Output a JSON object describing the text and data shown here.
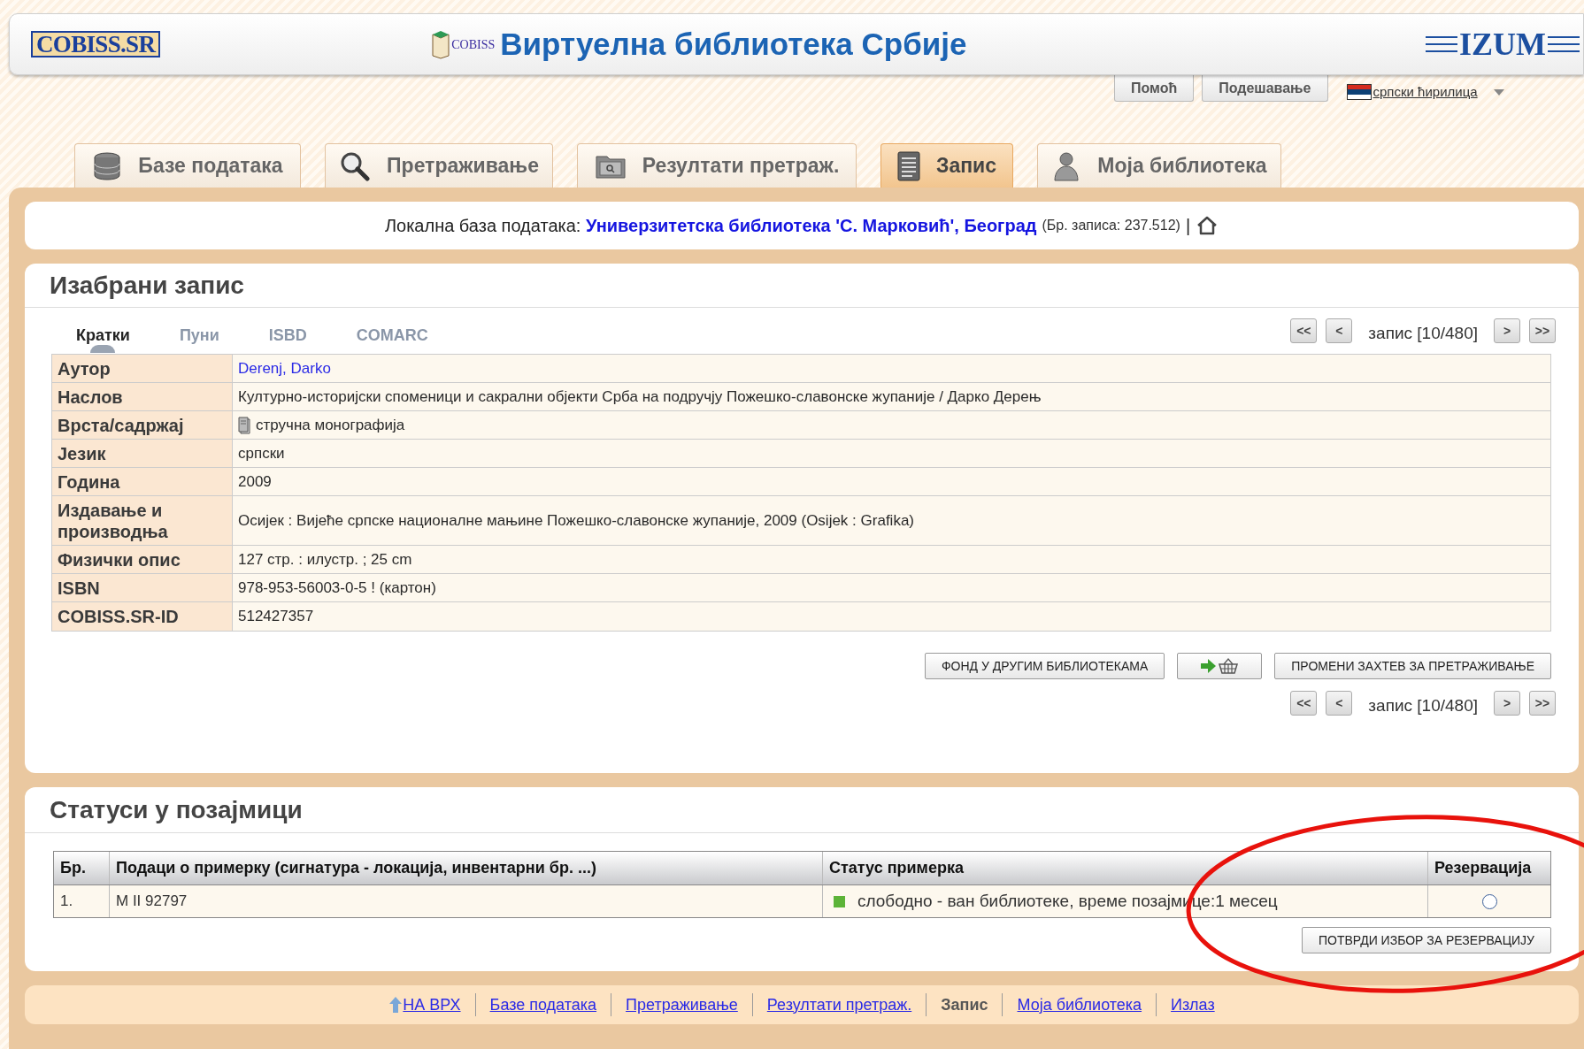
{
  "header": {
    "logo": "COBISS.SR",
    "emblem_text": "COBISS",
    "title": "Виртуелна библиотека Србије",
    "brand": "IZUM"
  },
  "top_buttons": [
    "Помоћ",
    "Подешавање"
  ],
  "language": {
    "label": "српски ћирилица"
  },
  "main_tabs": [
    {
      "label": "Базе података",
      "selected": false
    },
    {
      "label": "Претраживање",
      "selected": false
    },
    {
      "label": "Резултати претраж.",
      "selected": false
    },
    {
      "label": "Запис",
      "selected": true
    },
    {
      "label": "Моја библиотека",
      "selected": false
    }
  ],
  "database_bar": {
    "prefix": "Локална база података:",
    "library": "Универзитетска библиотека 'С. Марковић', Београд",
    "count": "(Бр. записа: 237.512)",
    "separator": "|"
  },
  "record_panel": {
    "title": "Изабрани запис",
    "view_tabs": [
      {
        "label": "Кратки",
        "selected": true
      },
      {
        "label": "Пуни",
        "selected": false
      },
      {
        "label": "ISBD",
        "selected": false
      },
      {
        "label": "COMARC",
        "selected": false
      }
    ],
    "pager_top": {
      "first": "<<",
      "prev": "<",
      "label": "запис [10/480]",
      "next": ">",
      "last": ">>"
    },
    "fields": [
      {
        "label": "Аутор",
        "value": "Derenj, Darko",
        "kind": "link"
      },
      {
        "label": "Наслов",
        "value": "Културно-историјски споменици и сакрални објекти Срба на подручју Пожешко-славонске жупаније / Дарко Дерењ",
        "kind": "text"
      },
      {
        "label": "Врста/садржај",
        "value": "стручна монографија",
        "kind": "material"
      },
      {
        "label": "Језик",
        "value": "српски",
        "kind": "text"
      },
      {
        "label": "Година",
        "value": "2009",
        "kind": "text"
      },
      {
        "label": "Издавање и производња",
        "value": "Осијек : Вијеће српске националне мањине Пожешко-славонске жупаније, 2009 (Osijek : Grafika)",
        "kind": "text"
      },
      {
        "label": "Физички опис",
        "value": "127 стр. : илустр. ; 25 cm",
        "kind": "text"
      },
      {
        "label": "ISBN",
        "value": "978-953-56003-0-5 ! (картон)",
        "kind": "text"
      },
      {
        "label": "COBISS.SR-ID",
        "value": "512427357",
        "kind": "text"
      }
    ],
    "actions": [
      "ФОНД У ДРУГИМ БИБЛИОТЕКАМА",
      "ПРОМЕНИ ЗАХТЕВ ЗА ПРЕТРАЖИВАЊЕ"
    ],
    "pager_bottom": {
      "first": "<<",
      "prev": "<",
      "label": "запис [10/480]",
      "next": ">",
      "last": ">>"
    }
  },
  "loans_panel": {
    "title": "Статуси у позајмици",
    "columns": [
      "Бр.",
      "Подаци о примерку (сигнатура - локација, инвентарни бр. ...)",
      "Статус примерка",
      "Резервација"
    ],
    "rows": [
      {
        "no": "1.",
        "item": "M II 92797",
        "status": "слободно - ван библиотеке, време позајмице:1 месец",
        "color": "#5cb338",
        "selected": false
      }
    ],
    "confirm_button": "ПОТВРДИ ИЗБОР ЗА РЕЗЕРВАЦИЈУ"
  },
  "footer": [
    {
      "label": "НА ВРХ",
      "kind": "top"
    },
    {
      "label": "Базе података",
      "kind": "link"
    },
    {
      "label": "Претраживање",
      "kind": "link"
    },
    {
      "label": "Резултати претраж.",
      "kind": "link"
    },
    {
      "label": "Запис",
      "kind": "current"
    },
    {
      "label": "Моја библиотека",
      "kind": "link"
    },
    {
      "label": "Излаз",
      "kind": "link"
    }
  ]
}
